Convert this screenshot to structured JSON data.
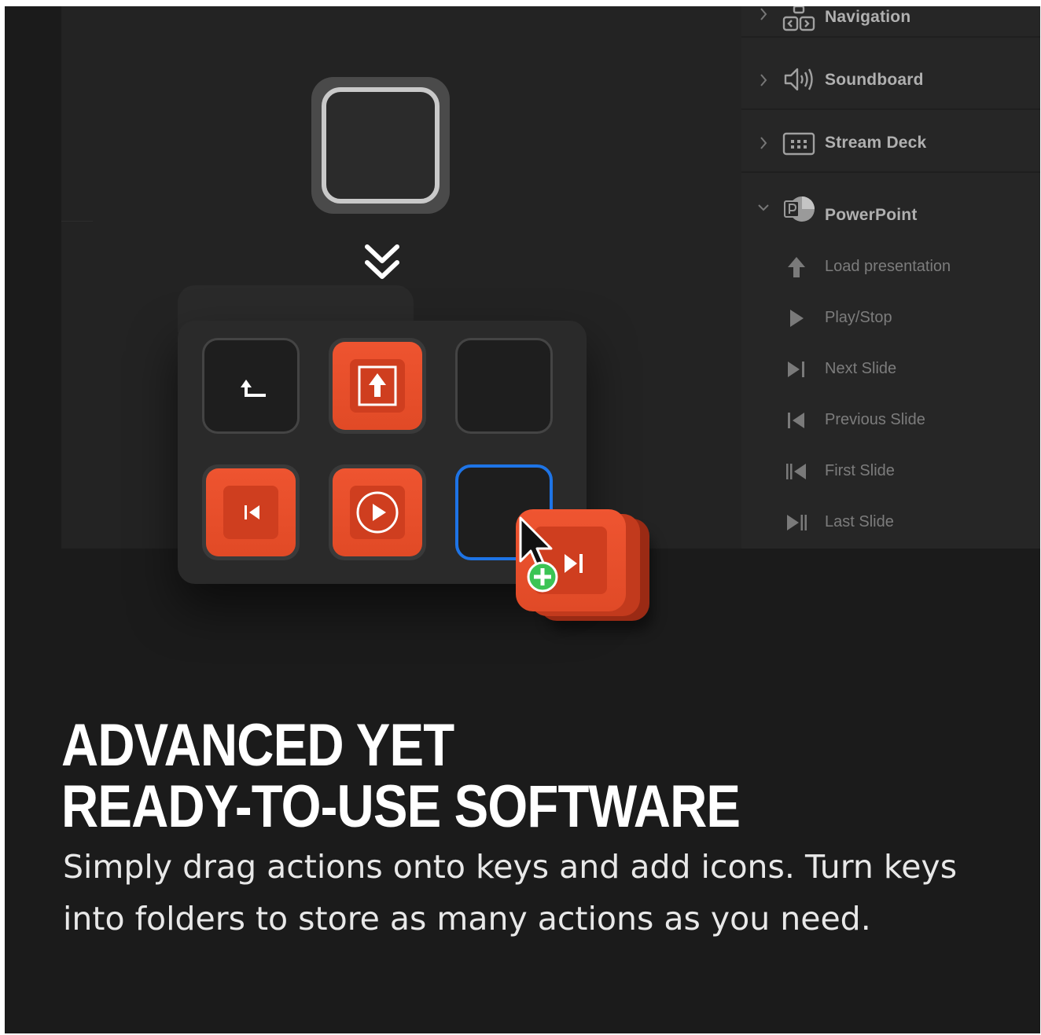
{
  "sidebar": {
    "categories": [
      {
        "label": "Navigation",
        "icon": "navigation-icon",
        "expanded": false
      },
      {
        "label": "Soundboard",
        "icon": "speaker-icon",
        "expanded": false
      },
      {
        "label": "Stream Deck",
        "icon": "stream-deck-icon",
        "expanded": false
      },
      {
        "label": "PowerPoint",
        "icon": "powerpoint-icon",
        "expanded": true
      }
    ],
    "actions": [
      {
        "label": "Load presentation",
        "icon": "upload-arrow-icon"
      },
      {
        "label": "Play/Stop",
        "icon": "play-icon"
      },
      {
        "label": "Next Slide",
        "icon": "next-slide-icon"
      },
      {
        "label": "Previous Slide",
        "icon": "previous-slide-icon"
      },
      {
        "label": "First Slide",
        "icon": "first-slide-icon"
      },
      {
        "label": "Last Slide",
        "icon": "last-slide-icon"
      }
    ]
  },
  "canvas": {
    "folder_key": "folder-key",
    "keys": [
      {
        "type": "back",
        "icon": "back-arrow-icon"
      },
      {
        "type": "action",
        "icon": "load-presentation-icon"
      },
      {
        "type": "empty"
      },
      {
        "type": "action",
        "icon": "previous-slide-icon"
      },
      {
        "type": "action",
        "icon": "play-circle-icon"
      },
      {
        "type": "empty-selected"
      }
    ],
    "dragged_action": {
      "icon": "next-slide-icon"
    }
  },
  "colors": {
    "accent_red": "#e84d29",
    "selection_blue": "#1e74e6",
    "add_green": "#3bc454",
    "background": "#1b1b1b"
  },
  "headline": {
    "line1": "ADVANCED YET",
    "line2": "READY-TO-USE SOFTWARE"
  },
  "subtext": "Simply drag actions onto keys and add icons. Turn keys into folders to store as many actions as you need."
}
